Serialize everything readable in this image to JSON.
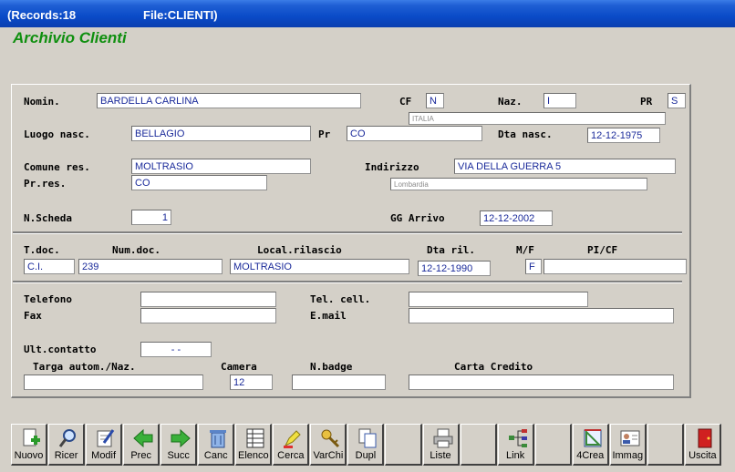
{
  "titlebar": {
    "records": "(Records:18",
    "file": "File:CLIENTI)"
  },
  "app_title": "Archivio Clienti",
  "form": {
    "nomin_label": "Nomin.",
    "nomin_value": "BARDELLA CARLINA",
    "cf_label": "CF",
    "cf_value": "N",
    "naz_label": "Naz.",
    "naz_value": "I",
    "pr_label": "PR",
    "pr_value": "S",
    "naz_info": "ITALIA",
    "luogo_label": "Luogo nasc.",
    "luogo_value": "BELLAGIO",
    "prov_label": "Pr",
    "prov_value": "CO",
    "dta_nasc_label": "Dta nasc.",
    "dta_nasc_value": "12-12-1975",
    "comune_label": "Comune res.",
    "comune_value": "MOLTRASIO",
    "indirizzo_label": "Indirizzo",
    "indirizzo_value": "VIA DELLA GUERRA 5",
    "prres_label": "Pr.res.",
    "prres_value": "CO",
    "regione_info": "Lombardia",
    "nscheda_label": "N.Scheda",
    "nscheda_value": "1",
    "gg_arrivo_label": "GG Arrivo",
    "gg_arrivo_value": "12-12-2002",
    "tdoc_label": "T.doc.",
    "tdoc_value": "C.I.",
    "numdoc_label": "Num.doc.",
    "numdoc_value": "239",
    "local_label": "Local.rilascio",
    "local_value": "MOLTRASIO",
    "dta_ril_label": "Dta ril.",
    "dta_ril_value": "12-12-1990",
    "mf_label": "M/F",
    "mf_value": "F",
    "picf_label": "PI/CF",
    "picf_value": "",
    "telefono_label": "Telefono",
    "telefono_value": "",
    "telcell_label": "Tel. cell.",
    "telcell_value": "",
    "fax_label": "Fax",
    "fax_value": "",
    "email_label": "E.mail",
    "email_value": "",
    "ultcont_label": "Ult.contatto",
    "ultcont_value": "-  -",
    "targa_label": "Targa autom./Naz.",
    "targa_value": "",
    "camera_label": "Camera",
    "camera_value": "12",
    "nbadge_label": "N.badge",
    "nbadge_value": "",
    "carta_label": "Carta Credito",
    "carta_value": ""
  },
  "toolbar": {
    "nuovo": "Nuovo",
    "ricer": "Ricer",
    "modif": "Modif",
    "prec": "Prec",
    "succ": "Succ",
    "canc": "Canc",
    "elenco": "Elenco",
    "cerca": "Cerca",
    "varchi": "VarChi",
    "dupl": "Dupl",
    "liste": "Liste",
    "link": "Link",
    "crea": "4Crea",
    "immag": "Immag",
    "uscita": "Uscita"
  }
}
